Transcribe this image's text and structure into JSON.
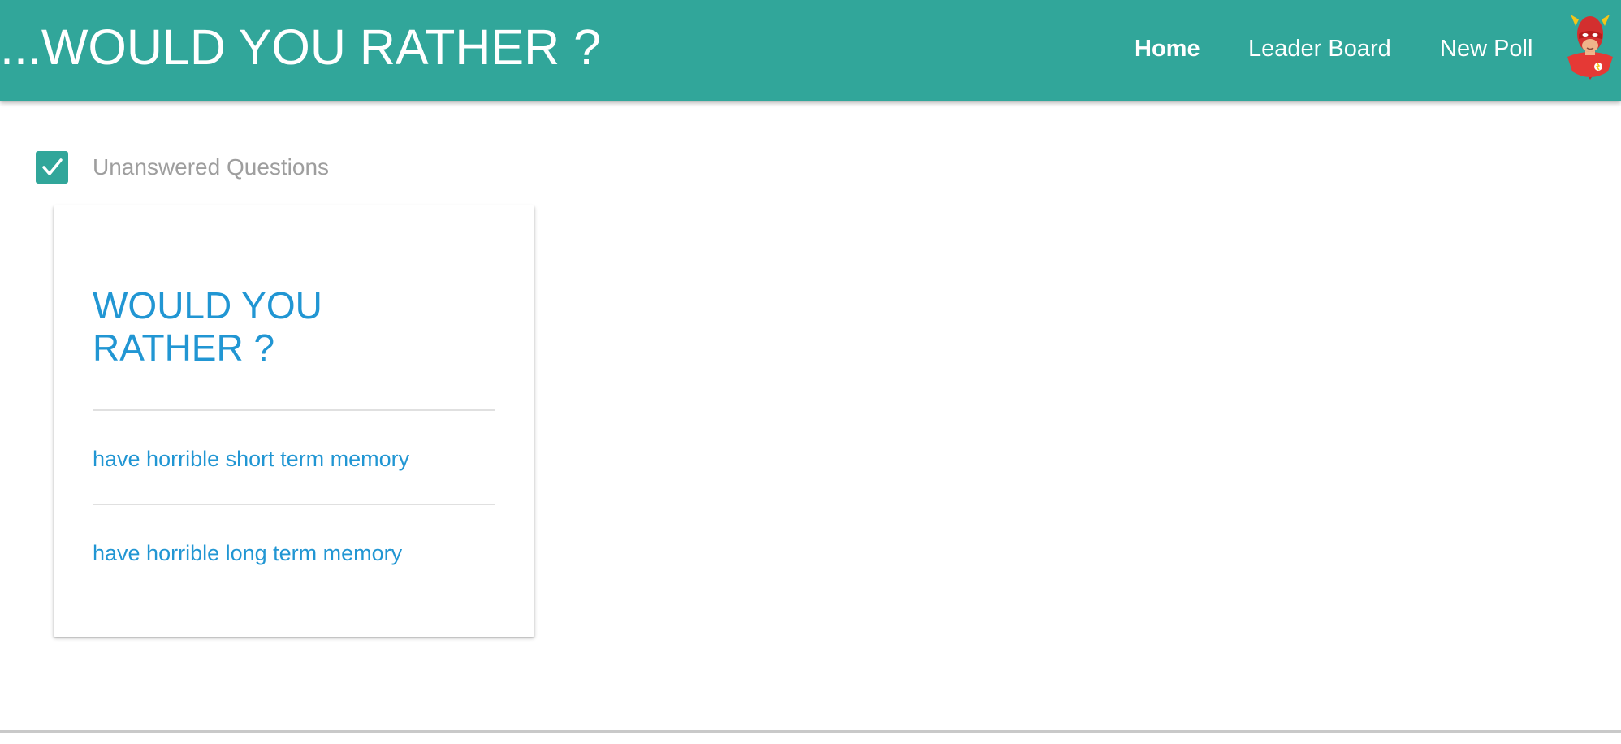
{
  "header": {
    "title": "...WOULD YOU RATHER ?",
    "nav": {
      "home": "Home",
      "leader_board": "Leader Board",
      "new_poll": "New Poll"
    },
    "avatar_icon": "superhero-avatar-icon",
    "background_color": "#31a69a"
  },
  "filter": {
    "checked": true,
    "label": "Unanswered Questions",
    "icon": "checkmark-icon"
  },
  "question_card": {
    "title": "WOULD YOU RATHER ?",
    "options": [
      "have horrible short term memory",
      "have horrible long term memory"
    ],
    "accent_color": "#2196d3"
  }
}
